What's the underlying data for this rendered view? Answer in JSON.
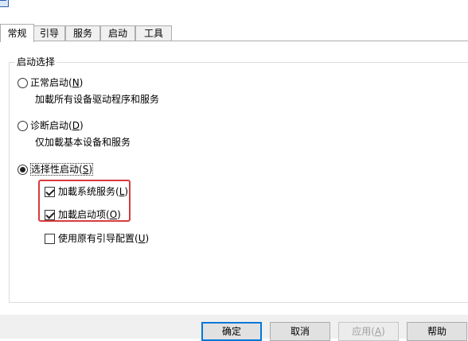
{
  "tabs": [
    {
      "label": "常规",
      "active": true
    },
    {
      "label": "引导",
      "active": false
    },
    {
      "label": "服务",
      "active": false
    },
    {
      "label": "启动",
      "active": false
    },
    {
      "label": "工具",
      "active": false
    }
  ],
  "startup_group": {
    "title": "启动选择",
    "normal": {
      "label": "正常启动(",
      "key": "N",
      "suffix": ")",
      "selected": false,
      "description": "加載所有设备驱动程序和服务"
    },
    "diagnostic": {
      "label": "诊断启动(",
      "key": "D",
      "suffix": ")",
      "selected": false,
      "description": "仅加載基本设备和服务"
    },
    "selective": {
      "label": "选择性启动(",
      "key": "S",
      "suffix": ")",
      "selected": true,
      "load_system_services": {
        "label": "加載系统服务(",
        "key": "L",
        "suffix": ")",
        "checked": true
      },
      "load_startup_items": {
        "label": "加載启动项(",
        "key": "O",
        "suffix": ")",
        "checked": true
      },
      "use_original_boot_config": {
        "label": "使用原有引导配置(",
        "key": "U",
        "suffix": ")",
        "checked": false
      }
    }
  },
  "buttons": {
    "ok": "确定",
    "cancel": "取消",
    "apply": {
      "label": "应用(",
      "key": "A",
      "suffix": ")",
      "enabled": false
    },
    "help": "帮助"
  },
  "colors": {
    "highlight": "#d83b3b",
    "default_button_border": "#0078d7",
    "disabled_text": "#a0a0a0"
  }
}
